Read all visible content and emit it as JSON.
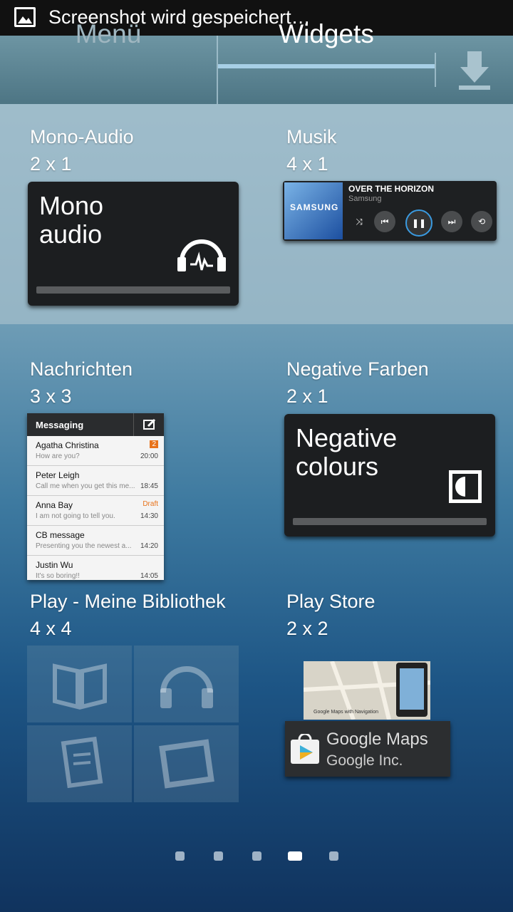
{
  "statusbar": {
    "text": "Screenshot wird gespeichert…",
    "icon": "image-icon"
  },
  "tabs": {
    "menu": "Menü",
    "widgets": "Widgets",
    "download_icon": "download-icon"
  },
  "widgets": [
    {
      "name": "Mono-Audio",
      "size": "2 x 1"
    },
    {
      "name": "Musik",
      "size": "4 x 1"
    },
    {
      "name": "Nachrichten",
      "size": "3 x 3"
    },
    {
      "name": "Negative Farben",
      "size": "2 x 1"
    },
    {
      "name": "Play - Meine Bibliothek",
      "size": "4 x 4"
    },
    {
      "name": "Play Store",
      "size": "2 x 2"
    }
  ],
  "mono": {
    "line1": "Mono",
    "line2": "audio"
  },
  "music": {
    "title": "OVER THE HORIZON",
    "artist": "Samsung",
    "art_text": "SAMSUNG"
  },
  "messaging": {
    "title": "Messaging",
    "rows": [
      {
        "name": "Agatha Christina",
        "preview": "How are you?",
        "time": "20:00",
        "badge": "2"
      },
      {
        "name": "Peter Leigh",
        "preview": "Call me when you get this me...",
        "time": "18:45"
      },
      {
        "name": "Anna Bay",
        "preview": "I am not going to tell you.",
        "time": "14:30",
        "draft": "Draft"
      },
      {
        "name": "CB message",
        "preview": "Presenting you the newest a...",
        "time": "14:20"
      },
      {
        "name": "Justin Wu",
        "preview": "It's so boring!!",
        "time": "14:05"
      }
    ]
  },
  "negative": {
    "line1": "Negative",
    "line2": "colours"
  },
  "store": {
    "app": "Google Maps",
    "publisher": "Google Inc.",
    "caption": "Google Maps with Navigation"
  },
  "pager": {
    "count": 5,
    "active": 4
  }
}
